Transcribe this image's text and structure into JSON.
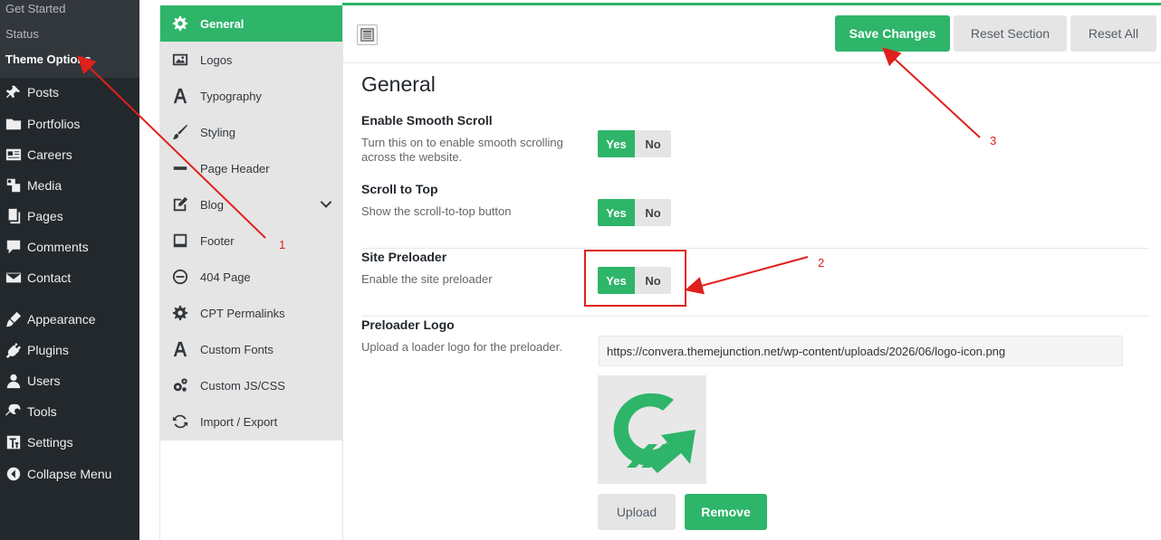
{
  "wp_sidebar": {
    "submenu": [
      "Get Started",
      "Status",
      "Theme Options"
    ],
    "items": [
      {
        "label": "Posts",
        "icon": "pin-icon"
      },
      {
        "label": "Portfolios",
        "icon": "folder-icon"
      },
      {
        "label": "Careers",
        "icon": "id-card-icon"
      },
      {
        "label": "Media",
        "icon": "media-icon"
      },
      {
        "label": "Pages",
        "icon": "pages-icon"
      },
      {
        "label": "Comments",
        "icon": "comment-icon"
      },
      {
        "label": "Contact",
        "icon": "mail-icon"
      },
      {
        "label": "Appearance",
        "icon": "brush-icon"
      },
      {
        "label": "Plugins",
        "icon": "plug-icon"
      },
      {
        "label": "Users",
        "icon": "user-icon"
      },
      {
        "label": "Tools",
        "icon": "wrench-icon"
      },
      {
        "label": "Settings",
        "icon": "settings-icon"
      },
      {
        "label": "Collapse Menu",
        "icon": "collapse-icon"
      }
    ]
  },
  "options_nav": {
    "items": [
      {
        "label": "General",
        "icon": "gear-icon",
        "active": true
      },
      {
        "label": "Logos",
        "icon": "image-icon"
      },
      {
        "label": "Typography",
        "icon": "font-icon"
      },
      {
        "label": "Styling",
        "icon": "brush-icon"
      },
      {
        "label": "Page Header",
        "icon": "minus-icon"
      },
      {
        "label": "Blog",
        "icon": "edit-icon"
      },
      {
        "label": "Footer",
        "icon": "footer-icon"
      },
      {
        "label": "404 Page",
        "icon": "no-entry-icon"
      },
      {
        "label": "CPT Permalinks",
        "icon": "gear-icon"
      },
      {
        "label": "Custom Fonts",
        "icon": "font-icon"
      },
      {
        "label": "Custom JS/CSS",
        "icon": "cogs-icon"
      },
      {
        "label": "Import / Export",
        "icon": "refresh-icon"
      }
    ]
  },
  "toolbar": {
    "save_label": "Save Changes",
    "reset_section_label": "Reset Section",
    "reset_all_label": "Reset All"
  },
  "section": {
    "title": "General",
    "fields": [
      {
        "title": "Enable Smooth Scroll",
        "desc": "Turn this on to enable smooth scrolling across the website.",
        "yes": "Yes",
        "no": "No",
        "value": "Yes"
      },
      {
        "title": "Scroll to Top",
        "desc": "Show the scroll-to-top button",
        "yes": "Yes",
        "no": "No",
        "value": "Yes"
      },
      {
        "title": "Site Preloader",
        "desc": "Enable the site preloader",
        "yes": "Yes",
        "no": "No",
        "value": "Yes"
      },
      {
        "title": "Preloader Logo",
        "desc": "Upload a loader logo for the preloader."
      }
    ],
    "preloader_url": "https://convera.themejunction.net/wp-content/uploads/2026/06/logo-icon.png",
    "upload_label": "Upload",
    "remove_label": "Remove"
  },
  "annotations": [
    "1",
    "2",
    "3"
  ],
  "colors": {
    "accent": "#2eb56a",
    "sidebar": "#23282d",
    "annotation": "#e0201a"
  }
}
